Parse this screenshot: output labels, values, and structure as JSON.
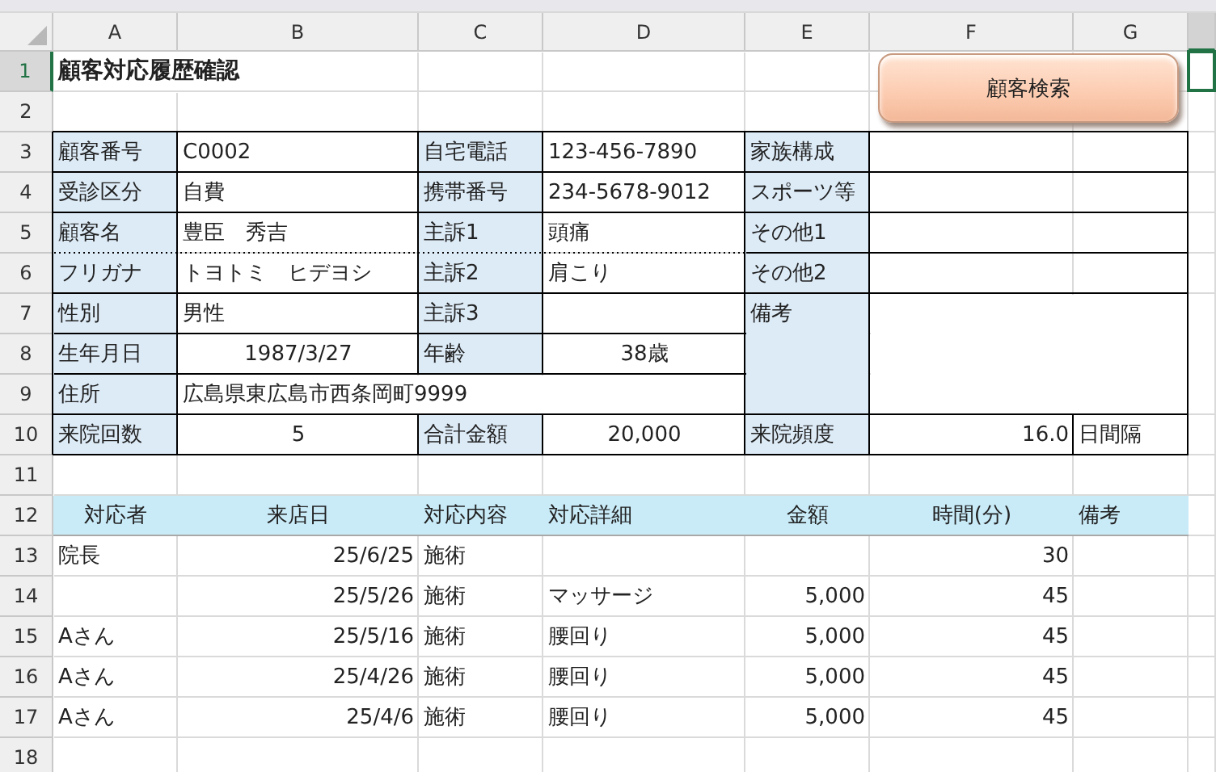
{
  "columns": [
    {
      "label": "A",
      "selected": false
    },
    {
      "label": "B",
      "selected": false
    },
    {
      "label": "C",
      "selected": false
    },
    {
      "label": "D",
      "selected": false
    },
    {
      "label": "E",
      "selected": false
    },
    {
      "label": "F",
      "selected": false
    },
    {
      "label": "G",
      "selected": false
    },
    {
      "selected": true
    }
  ],
  "rows": [
    {
      "label": "1",
      "selected": true
    },
    {
      "label": "2",
      "selected": false
    },
    {
      "label": "3",
      "selected": false
    },
    {
      "label": "4",
      "selected": false
    },
    {
      "label": "5",
      "selected": false
    },
    {
      "label": "6",
      "selected": false
    },
    {
      "label": "7",
      "selected": false
    },
    {
      "label": "8",
      "selected": false
    },
    {
      "label": "9",
      "selected": false
    },
    {
      "label": "10",
      "selected": false
    },
    {
      "label": "11",
      "selected": false
    },
    {
      "label": "12",
      "selected": false
    },
    {
      "label": "13",
      "selected": false
    },
    {
      "label": "14",
      "selected": false
    },
    {
      "label": "15",
      "selected": false
    },
    {
      "label": "16",
      "selected": false
    },
    {
      "label": "17",
      "selected": false
    },
    {
      "label": "18",
      "selected": false
    }
  ],
  "title": "顧客対応履歴確認",
  "button": {
    "label": "顧客検索"
  },
  "form": [
    {
      "label": "顧客番号",
      "value": "C0002"
    },
    {
      "label": "自宅電話",
      "value": "123-456-7890"
    },
    {
      "label": "家族構成"
    },
    {
      "label": "受診区分",
      "value": "自費"
    },
    {
      "label": "携帯番号",
      "value": "234-5678-9012"
    },
    {
      "label": "スポーツ等"
    },
    {
      "label": "顧客名",
      "value": "豊臣　秀吉"
    },
    {
      "label": "主訴1",
      "value": "頭痛"
    },
    {
      "label": "その他1"
    },
    {
      "label": "フリガナ",
      "value": "トヨトミ　ヒデヨシ"
    },
    {
      "label": "主訴2",
      "value": "肩こり"
    },
    {
      "label": "その他2"
    },
    {
      "label": "性別",
      "value": "男性"
    },
    {
      "label": "主訴3"
    },
    {
      "label": "備考"
    },
    {
      "label": "生年月日",
      "value": "1987/3/27"
    },
    {
      "label": "年齢",
      "value": "38歳"
    },
    {
      "label": "住所",
      "value": "広島県東広島市西条岡町9999"
    },
    {
      "label": "来院回数",
      "value": "5"
    },
    {
      "label": "合計金額",
      "value": "20,000"
    },
    {
      "label": "来院頻度",
      "value": "16.0",
      "unit": "日間隔"
    }
  ],
  "history": {
    "columns": [
      "対応者",
      "来店日",
      "対応内容",
      "対応詳細",
      "金額",
      "時間(分)",
      "備考"
    ],
    "rows": [
      {
        "staff": "院長",
        "date": "25/6/25",
        "service": "施術",
        "minutes": "30"
      },
      {
        "date": "25/5/26",
        "service": "施術",
        "detail": "マッサージ",
        "amount": "5,000",
        "minutes": "45"
      },
      {
        "staff": "Aさん",
        "date": "25/5/16",
        "service": "施術",
        "detail": "腰回り",
        "amount": "5,000",
        "minutes": "45"
      },
      {
        "staff": "Aさん",
        "date": "25/4/26",
        "service": "施術",
        "detail": "腰回り",
        "amount": "5,000",
        "minutes": "45"
      },
      {
        "staff": "Aさん",
        "date": "25/4/6",
        "service": "施術",
        "detail": "腰回り",
        "amount": "5,000",
        "minutes": "45"
      }
    ]
  }
}
